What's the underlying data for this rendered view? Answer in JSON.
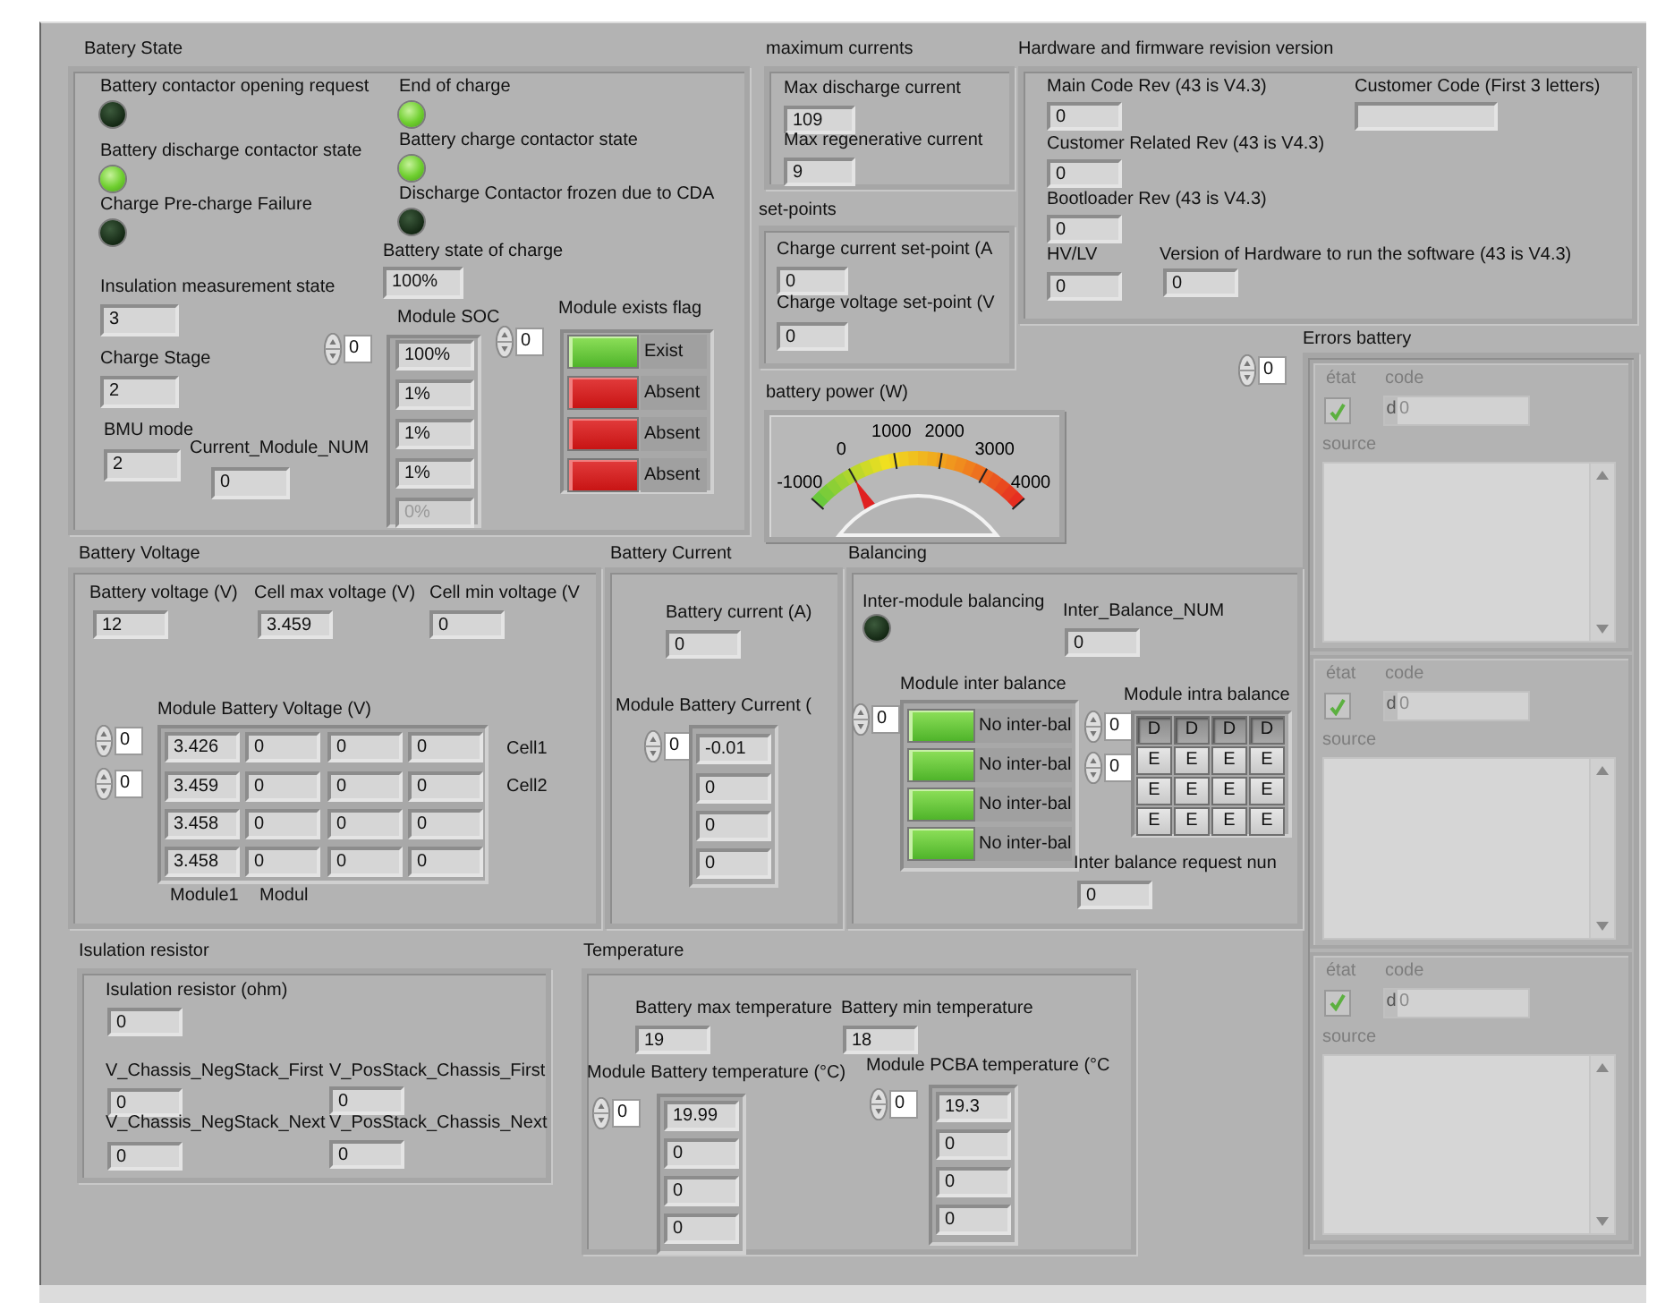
{
  "sections": [
    {
      "title": "Batery State",
      "items": [
        {
          "kind": "led",
          "label": "Battery contactor opening request",
          "on": false
        },
        {
          "kind": "led",
          "label": "Battery discharge contactor state",
          "on": true
        },
        {
          "kind": "led",
          "label": "Charge Pre-charge Failure",
          "on": false
        },
        {
          "kind": "led",
          "label": "End of charge",
          "on": true
        },
        {
          "kind": "led",
          "label": "Battery charge contactor state",
          "on": true
        },
        {
          "kind": "led",
          "label": "Discharge Contactor frozen due to CDA",
          "on": false
        },
        {
          "kind": "numeric",
          "label": "Battery state of charge",
          "value": "100%"
        },
        {
          "kind": "numeric",
          "label": "Insulation measurement state",
          "value": "3"
        },
        {
          "kind": "numeric",
          "label": "Charge Stage",
          "value": "2"
        },
        {
          "kind": "numeric",
          "label": "BMU mode",
          "value": "2"
        },
        {
          "kind": "numeric",
          "label": "Current_Module_NUM",
          "value": "0"
        },
        {
          "kind": "array",
          "label": "Module SOC",
          "index": [
            "0"
          ],
          "rows": [
            {
              "cells": [
                "100%"
              ],
              "disabled": false
            },
            {
              "cells": [
                "1%"
              ],
              "disabled": false
            },
            {
              "cells": [
                "1%"
              ],
              "disabled": false
            },
            {
              "cells": [
                "1%"
              ],
              "disabled": false
            },
            {
              "cells": [
                "0%"
              ],
              "disabled": true
            }
          ]
        },
        {
          "kind": "boolarray",
          "label": "Module exists flag",
          "index": [
            "0"
          ],
          "elements": [
            {
              "text": "Exist",
              "on": true
            },
            {
              "text": "Absent",
              "on": false
            },
            {
              "text": "Absent",
              "on": false
            },
            {
              "text": "Absent",
              "on": false
            }
          ]
        }
      ]
    },
    {
      "title": "maximum currents",
      "items": [
        {
          "kind": "numeric",
          "label": "Max discharge current",
          "value": "109"
        },
        {
          "kind": "numeric",
          "label": "Max regenerative current",
          "value": "9"
        }
      ]
    },
    {
      "title": "set-points",
      "items": [
        {
          "kind": "numeric",
          "label": "Charge current set-point (A",
          "value": "0"
        },
        {
          "kind": "numeric",
          "label": "Charge voltage set-point (V",
          "value": "0"
        }
      ]
    },
    {
      "title": "battery power (W)",
      "items": [
        {
          "kind": "gauge",
          "ticks": [
            "-1000",
            "0",
            "1000",
            "2000",
            "3000",
            "4000"
          ],
          "level": 0.2
        }
      ]
    },
    {
      "title": "Hardware and firmware revision version",
      "items": [
        {
          "kind": "numeric",
          "label": "Main Code Rev (43 is V4.3)",
          "value": "0"
        },
        {
          "kind": "numeric",
          "label": "Customer Code (First 3 letters)"
        },
        {
          "kind": "numeric",
          "label": "Customer Related Rev (43 is V4.3)",
          "value": "0"
        },
        {
          "kind": "numeric",
          "label": "Bootloader Rev (43 is V4.3)",
          "value": "0"
        },
        {
          "kind": "numeric",
          "label": "HV/LV",
          "value": "0"
        },
        {
          "kind": "numeric",
          "label": "Version of Hardware to run the software (43 is V4.3)",
          "value": "0"
        }
      ]
    },
    {
      "title": "Errors battery",
      "items": [
        {
          "kind": "errors",
          "index": [
            "0"
          ],
          "elements": [
            {
              "status_label": "état",
              "checked": true,
              "code_label": "code",
              "radix": "d",
              "code": "0",
              "source_label": "source"
            },
            {
              "status_label": "état",
              "checked": true,
              "code_label": "code",
              "radix": "d",
              "code": "0",
              "source_label": "source"
            },
            {
              "status_label": "état",
              "checked": true,
              "code_label": "code",
              "radix": "d",
              "code": "0",
              "source_label": "source"
            }
          ]
        }
      ]
    },
    {
      "title": "Battery Voltage",
      "items": [
        {
          "kind": "numeric",
          "label": "Battery voltage (V)",
          "value": "12"
        },
        {
          "kind": "numeric",
          "label": "Cell max voltage (V)",
          "value": "3.459"
        },
        {
          "kind": "numeric",
          "label": "Cell min voltage (V",
          "value": "0"
        },
        {
          "kind": "array",
          "label": "Module Battery Voltage (V)",
          "index": [
            "0",
            "0"
          ],
          "rows": [
            {
              "cells": [
                "3.426",
                "0",
                "0",
                "0"
              ],
              "disabled": false
            },
            {
              "cells": [
                "3.459",
                "0",
                "0",
                "0"
              ],
              "disabled": false
            },
            {
              "cells": [
                "3.458",
                "0",
                "0",
                "0"
              ],
              "disabled": false
            },
            {
              "cells": [
                "3.458",
                "0",
                "0",
                "0"
              ],
              "disabled": false
            }
          ]
        },
        {
          "kind": "caption",
          "text": "Cell1"
        },
        {
          "kind": "caption",
          "text": "Cell2"
        },
        {
          "kind": "caption",
          "text": "Module1"
        },
        {
          "kind": "caption",
          "text": "Modul"
        }
      ]
    },
    {
      "title": "Battery Current",
      "items": [
        {
          "kind": "numeric",
          "label": "Battery current (A)",
          "value": "0"
        },
        {
          "kind": "array",
          "label": "Module Battery Current (",
          "index": [
            "0"
          ],
          "rows": [
            {
              "cells": [
                "-0.01"
              ],
              "disabled": false
            },
            {
              "cells": [
                "0"
              ],
              "disabled": false
            },
            {
              "cells": [
                "0"
              ],
              "disabled": false
            },
            {
              "cells": [
                "0"
              ],
              "disabled": false
            }
          ]
        }
      ]
    },
    {
      "title": "Balancing",
      "items": [
        {
          "kind": "led",
          "label": "Inter-module balancing",
          "on": false
        },
        {
          "kind": "numeric",
          "label": "Inter_Balance_NUM",
          "value": "0"
        },
        {
          "kind": "boolarray",
          "label": "Module inter balance",
          "index": [
            "0"
          ],
          "elements": [
            {
              "text": "No inter-bal",
              "on": true
            },
            {
              "text": "No inter-bal",
              "on": true
            },
            {
              "text": "No inter-bal",
              "on": true
            },
            {
              "text": "No inter-bal",
              "on": true
            }
          ]
        },
        {
          "kind": "buttongrid",
          "label": "Module intra balance",
          "index": [
            "0",
            "0"
          ],
          "rows": [
            [
              {
                "text": "D",
                "pressed": true
              },
              {
                "text": "D",
                "pressed": true
              },
              {
                "text": "D",
                "pressed": true
              },
              {
                "text": "D",
                "pressed": true
              }
            ],
            [
              {
                "text": "E",
                "pressed": false
              },
              {
                "text": "E",
                "pressed": false
              },
              {
                "text": "E",
                "pressed": false
              },
              {
                "text": "E",
                "pressed": false
              }
            ],
            [
              {
                "text": "E",
                "pressed": false
              },
              {
                "text": "E",
                "pressed": false
              },
              {
                "text": "E",
                "pressed": false
              },
              {
                "text": "E",
                "pressed": false
              }
            ],
            [
              {
                "text": "E",
                "pressed": false
              },
              {
                "text": "E",
                "pressed": false
              },
              {
                "text": "E",
                "pressed": false
              },
              {
                "text": "E",
                "pressed": false
              }
            ]
          ]
        },
        {
          "kind": "numeric",
          "label": "Inter balance request nun",
          "value": "0"
        }
      ]
    },
    {
      "title": "Isulation resistor",
      "items": [
        {
          "kind": "numeric",
          "label": "Isulation resistor (ohm)",
          "value": "0"
        },
        {
          "kind": "numeric",
          "label": "V_Chassis_NegStack_First",
          "value": "0"
        },
        {
          "kind": "numeric",
          "label": "V_PosStack_Chassis_First",
          "value": "0"
        },
        {
          "kind": "numeric",
          "label": "V_Chassis_NegStack_Next",
          "value": "0"
        },
        {
          "kind": "numeric",
          "label": "V_PosStack_Chassis_Next",
          "value": "0"
        }
      ]
    },
    {
      "title": "Temperature",
      "items": [
        {
          "kind": "numeric",
          "label": "Battery max temperature",
          "value": "19"
        },
        {
          "kind": "numeric",
          "label": "Battery min temperature",
          "value": "18"
        },
        {
          "kind": "array",
          "label": "Module Battery temperature (°C)",
          "index": [
            "0"
          ],
          "rows": [
            {
              "cells": [
                "19.99"
              ],
              "disabled": false
            },
            {
              "cells": [
                "0"
              ],
              "disabled": false
            },
            {
              "cells": [
                "0"
              ],
              "disabled": false
            },
            {
              "cells": [
                "0"
              ],
              "disabled": false
            }
          ]
        },
        {
          "kind": "array",
          "label": "Module PCBA temperature (°C",
          "index": [
            "0"
          ],
          "rows": [
            {
              "cells": [
                "19.3"
              ],
              "disabled": false
            },
            {
              "cells": [
                "0"
              ],
              "disabled": false
            },
            {
              "cells": [
                "0"
              ],
              "disabled": false
            },
            {
              "cells": [
                "0"
              ],
              "disabled": false
            }
          ]
        }
      ]
    }
  ]
}
